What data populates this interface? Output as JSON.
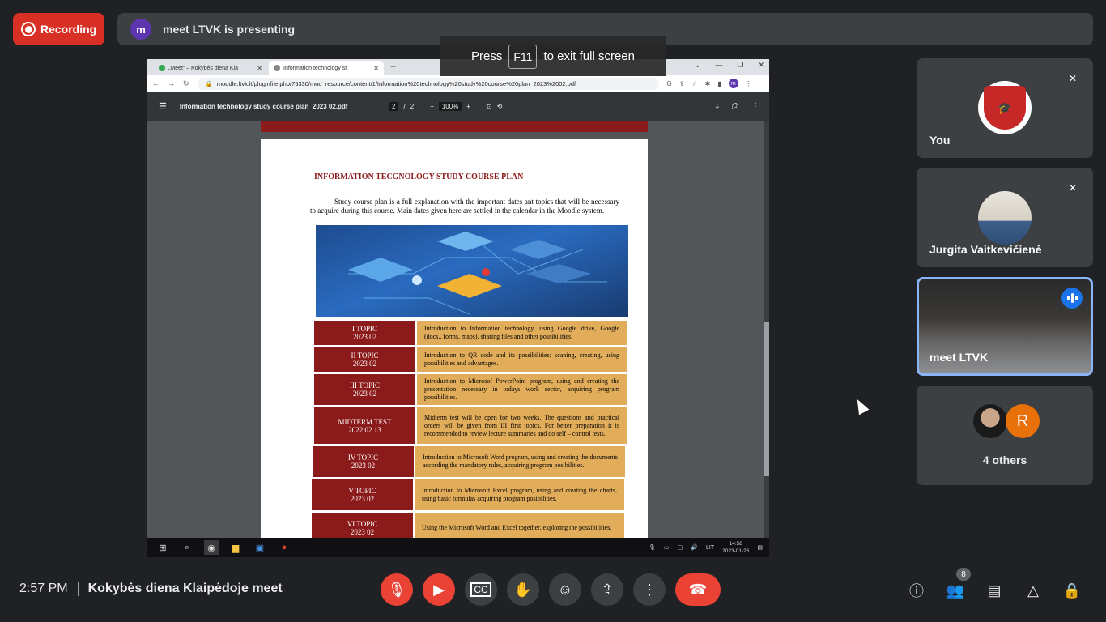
{
  "recording": {
    "label": "Recording"
  },
  "presenting": {
    "avatar_letter": "m",
    "text": "meet LTVK is presenting"
  },
  "fullscreen_hint": {
    "press": "Press",
    "key": "F11",
    "rest": "to exit full screen"
  },
  "browser": {
    "tabs": [
      {
        "label": "„Meet“ – Kokybės diena Kla"
      },
      {
        "label": "Information technology st"
      }
    ],
    "url": "moodle.ltvk.lt/pluginfile.php/75330/mod_resource/content/1/Information%20technology%20study%20course%20plan_2023%2002.pdf",
    "profile_letter": "m"
  },
  "pdf": {
    "filename": "Information technology study course plan_2023 02.pdf",
    "page_current": "2",
    "page_sep": "/",
    "page_total": "2",
    "zoom": "100%"
  },
  "document": {
    "title": "INFORMATION TECGNOLOGY STUDY COURSE PLAN",
    "paragraph": "Study course plan is a full explanation with the important dates ant topics that will be necessary to acquire during this course. Main dates given here are settled in the calendar in the Moodle system.",
    "topics": [
      {
        "name": "I TOPIC",
        "date": "2023 02",
        "desc": "Introduction to Information technology, using Google drive, Google (docs., forms, maps), sharing files and other possibilities."
      },
      {
        "name": "II TOPIC",
        "date": "2023 02",
        "desc": "Introduction to QR code and its possibilities: scaning, creating, using possibilities and advantages."
      },
      {
        "name": "III TOPIC",
        "date": "2023 02",
        "desc": "Introduction to Microsof PowerPoint program, using and creating the presentation necessary in todays work sector, acquiring program possibilities."
      },
      {
        "name": "MIDTERM TEST",
        "date": "2022 02 13",
        "desc": "Midterm test will be open for two weeks. The questions and practical orders will be given from III first topics. For better preparation it is recommended to review lecture summaries and do self – control tests."
      },
      {
        "name": "IV TOPIC",
        "date": "2023 02",
        "desc": "Introduction to Microsoft Word program, using and creating the documents according the mandatory rules, acquiring program posibilities."
      },
      {
        "name": "V TOPIC",
        "date": "2023 02",
        "desc": "Introduction to Microsoft Excel program, using and creating the charts, using basic formulas acquiring program posibilities."
      },
      {
        "name": "VI TOPIC",
        "date": "2023 02",
        "desc": "Using the Microsoft Word and Excel together, exploring the possibilities."
      }
    ]
  },
  "taskbar": {
    "lang": "LIT",
    "time": "14:58",
    "date": "2023-01-26"
  },
  "participants": {
    "you": {
      "name": "You"
    },
    "jurgita": {
      "name": "Jurgita Vaitkevičienė"
    },
    "presenter": {
      "name": "meet LTVK"
    },
    "others": {
      "label": "4 others",
      "avatar_letter": "R"
    }
  },
  "bottom": {
    "time": "2:57 PM",
    "meeting_title": "Kokybės diena Klaipėdoje meet",
    "people_count": "8"
  },
  "colors": {
    "recording": "#d93025",
    "end_call": "#ea4335",
    "accent": "#8ab4f8",
    "topic_dark": "#8b1a1a",
    "topic_light": "#e1ad5b"
  }
}
